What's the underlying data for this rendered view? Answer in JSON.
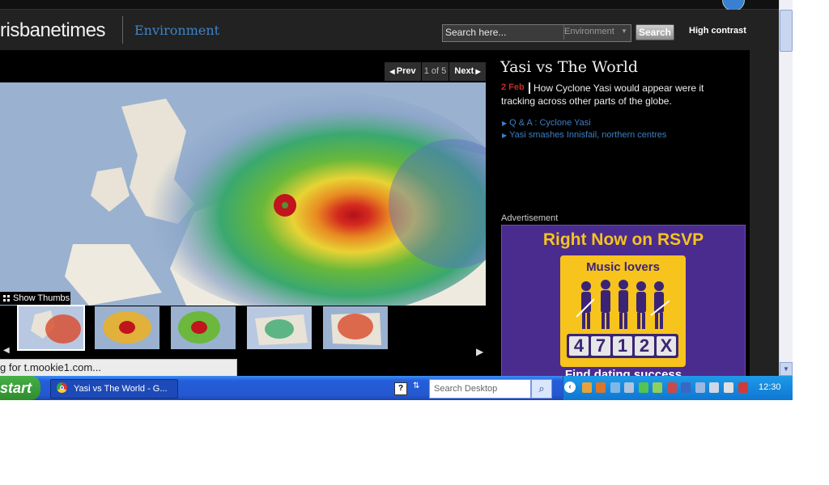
{
  "header": {
    "site_title": "risbanetimes",
    "section": "Environment",
    "search_placeholder": "Search here...",
    "search_scope": "Environment",
    "search_button": "Search",
    "high_contrast": "High contrast"
  },
  "gallery": {
    "prev": "Prev",
    "next": "Next",
    "counter": "1 of 5",
    "show_thumbs": "Show Thumbs"
  },
  "article": {
    "title": "Yasi vs The World",
    "date": "2 Feb",
    "description": "How Cyclone Yasi would appear were it tracking across other parts of the globe.",
    "related": [
      "Q & A : Cyclone Yasi",
      "Yasi smashes Innisfail, northern centres"
    ]
  },
  "ad": {
    "label": "Advertisement",
    "headline": "Right Now on RSVP",
    "card_title": "Music lovers",
    "counter_digits": [
      "4",
      "7",
      "1",
      "2",
      "X"
    ],
    "bottom": "Find dating success"
  },
  "status_bar": "g for t.mookie1.com...",
  "taskbar": {
    "start": "start",
    "task_title": "Yasi vs The World - G...",
    "search_placeholder": "Search Desktop",
    "clock": "12:30"
  },
  "colors": {
    "accent_blue": "#3d84c6",
    "date_red": "#c52b2b",
    "ad_purple": "#4a2b8e",
    "ad_yellow": "#f7c31d",
    "taskbar_blue": "#245edb"
  }
}
